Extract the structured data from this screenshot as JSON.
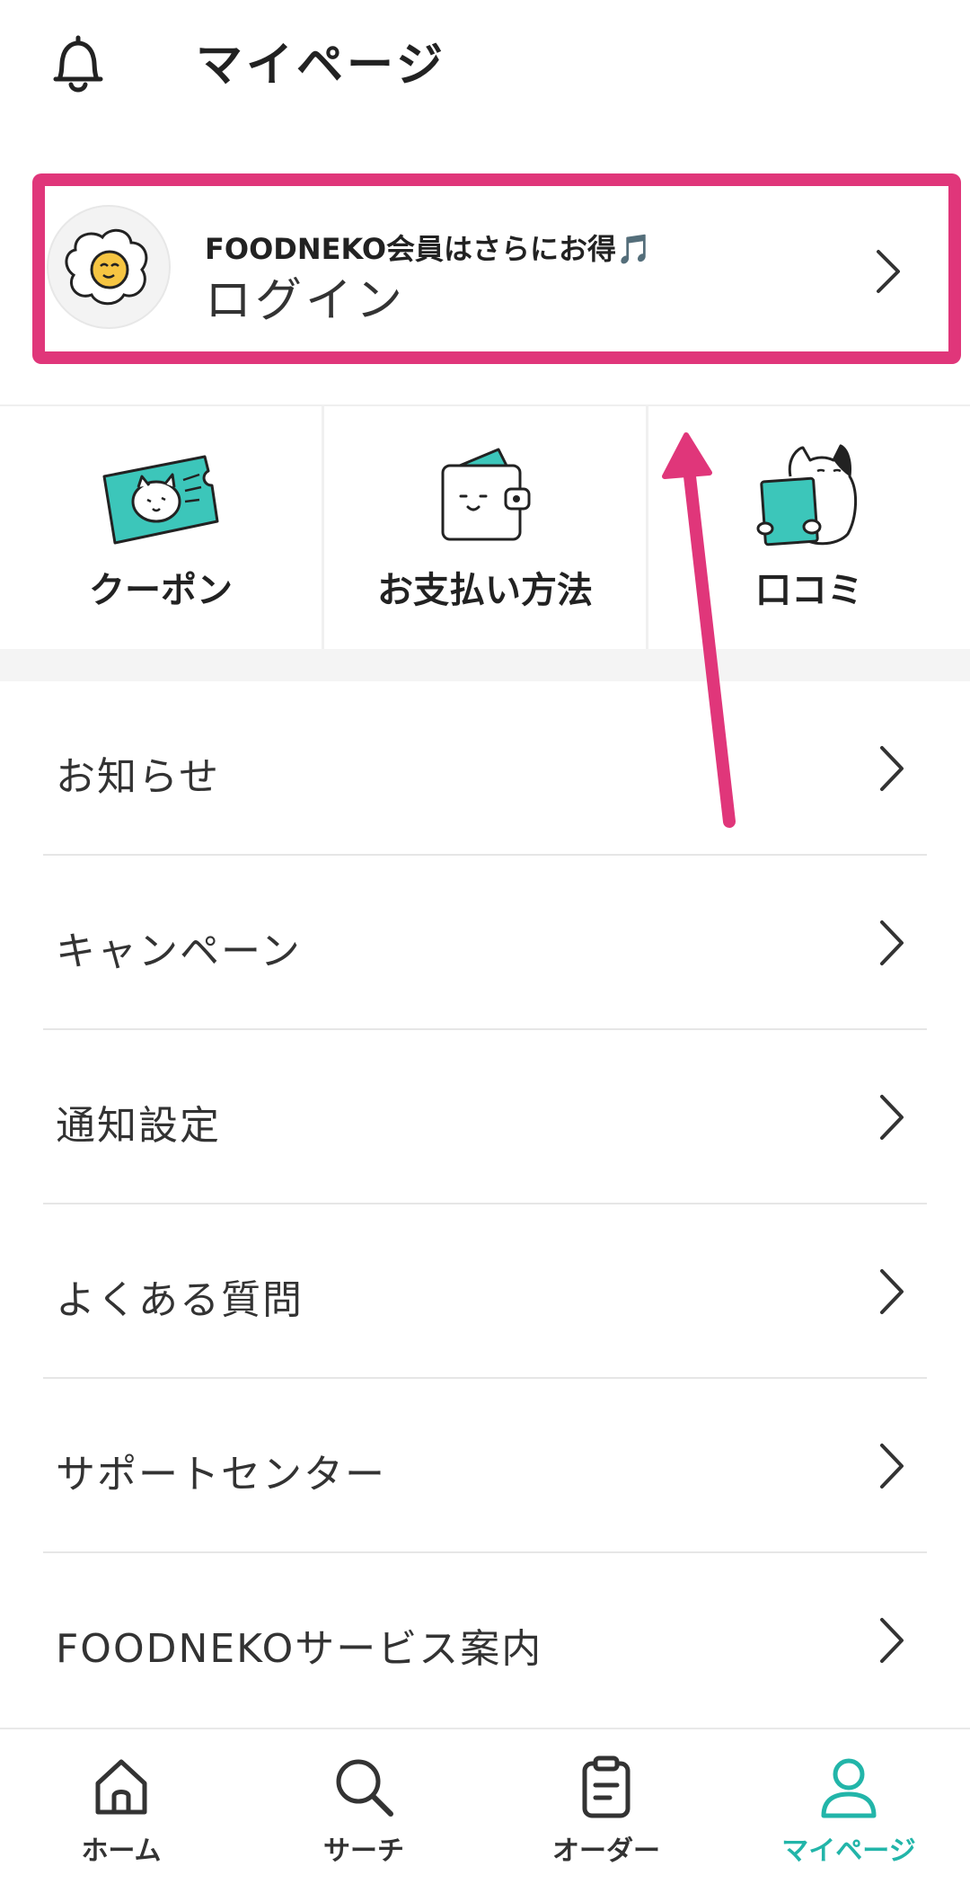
{
  "header": {
    "title": "マイページ"
  },
  "login_card": {
    "subtitle": "FOODNEKO会員はさらにお得🎵",
    "action_label": "ログイン"
  },
  "shortcuts": [
    {
      "label": "クーポン",
      "icon": "coupon-cat-icon"
    },
    {
      "label": "お支払い方法",
      "icon": "wallet-icon"
    },
    {
      "label": "口コミ",
      "icon": "review-cat-icon"
    }
  ],
  "menu": [
    {
      "label": "お知らせ"
    },
    {
      "label": "キャンペーン"
    },
    {
      "label": "通知設定"
    },
    {
      "label": "よくある質問"
    },
    {
      "label": "サポートセンター"
    },
    {
      "label": "FOODNEKOサービス案内"
    }
  ],
  "tabbar": [
    {
      "label": "ホーム",
      "icon": "home-icon"
    },
    {
      "label": "サーチ",
      "icon": "search-icon"
    },
    {
      "label": "オーダー",
      "icon": "clipboard-icon"
    },
    {
      "label": "マイページ",
      "icon": "user-icon",
      "active": true
    }
  ],
  "colors": {
    "accent": "#22B5A9",
    "highlight": "#E0367A"
  }
}
